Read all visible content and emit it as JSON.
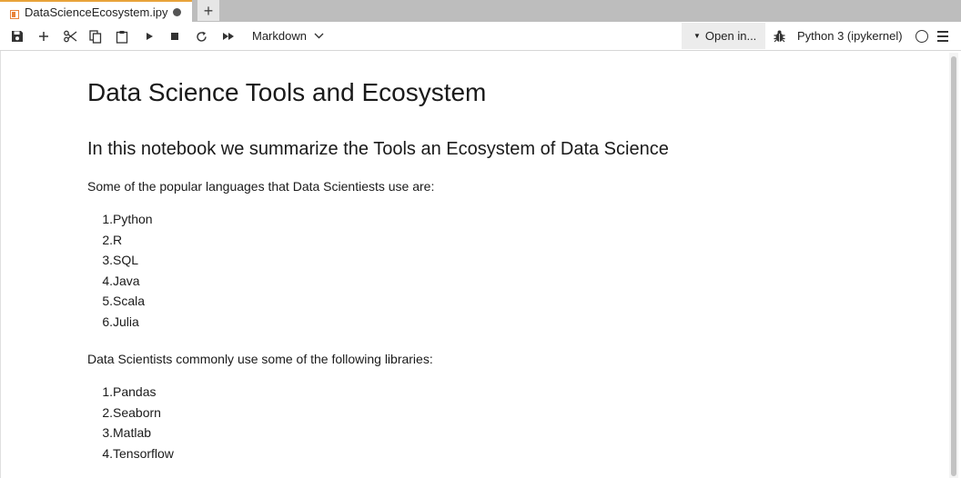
{
  "tab": {
    "title": "DataScienceEcosystem.ipy",
    "accent_color": "#e8a33a",
    "new_tab_label": "+"
  },
  "toolbar": {
    "icons": [
      "save-icon",
      "add-cell-icon",
      "cut-icon",
      "copy-icon",
      "paste-icon",
      "run-icon",
      "stop-icon",
      "restart-icon",
      "run-all-icon"
    ],
    "cell_type": "Markdown",
    "open_in_label": "Open in...",
    "kernel_name": "Python 3 (ipykernel)"
  },
  "notebook": {
    "title": "Data Science Tools and Ecosystem",
    "subtitle": "In this notebook we summarize the Tools an Ecosystem of Data Science",
    "languages_intro": "Some of the popular languages that Data Scientiests use are:",
    "languages": [
      "Python",
      "R",
      "SQL",
      "Java",
      "Scala",
      "Julia"
    ],
    "libraries_intro": "Data Scientists commonly use some of the following libraries:",
    "libraries": [
      "Pandas",
      "Seaborn",
      "Matlab",
      "Tensorflow"
    ]
  }
}
